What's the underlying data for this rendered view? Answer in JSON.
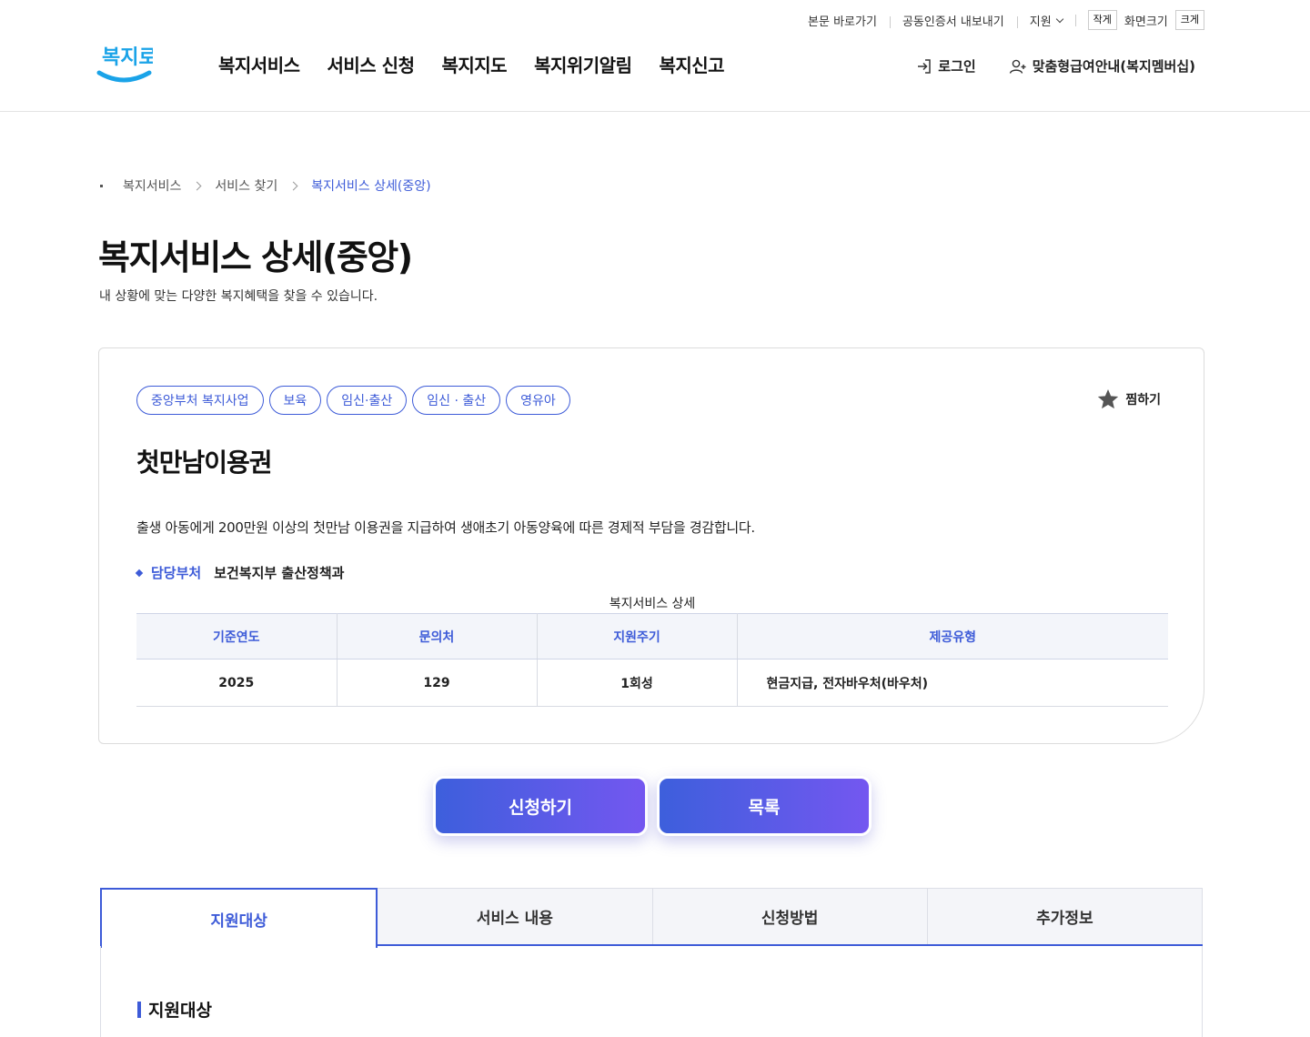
{
  "utility": {
    "skip_to_content": "본문 바로가기",
    "cert_export": "공동인증서 내보내기",
    "support": "지원",
    "zoom_small": "작게",
    "zoom_label": "화면크기",
    "zoom_large": "크게"
  },
  "header": {
    "logo_text": "복지로",
    "gnb": [
      "복지서비스",
      "서비스 신청",
      "복지지도",
      "복지위기알림",
      "복지신고"
    ],
    "login": "로그인",
    "membership": "맞춤형급여안내(복지멤버십)"
  },
  "breadcrumb": [
    "복지서비스",
    "서비스 찾기",
    "복지서비스 상세(중앙)"
  ],
  "page": {
    "title": "복지서비스 상세(중앙)",
    "description": "내 상황에 맞는 다양한 복지혜택을 찾을 수 있습니다."
  },
  "service": {
    "tags": [
      "중앙부처 복지사업",
      "보육",
      "임신·출산",
      "임신 · 출산",
      "영유아"
    ],
    "favorite": "찜하기",
    "name": "첫만남이용권",
    "description": "출생 아동에게 200만원 이상의 첫만남 이용권을 지급하여 생애초기 아동양육에 따른 경제적 부담을 경감합니다.",
    "dept_label": "담당부처",
    "dept_value": "보건복지부 출산정책과",
    "table": {
      "caption": "복지서비스 상세",
      "headers": [
        "기준연도",
        "문의처",
        "지원주기",
        "제공유형"
      ],
      "row": [
        "2025",
        "129",
        "1회성",
        "현금지급, 전자바우처(바우처)"
      ]
    }
  },
  "buttons": {
    "apply": "신청하기",
    "list": "목록"
  },
  "tabs": [
    "지원대상",
    "서비스 내용",
    "신청방법",
    "추가정보"
  ],
  "section": {
    "title": "지원대상"
  },
  "colors": {
    "accent": "#3d5bd8",
    "gradient_start": "#3d5fdc",
    "gradient_end": "#7457f0",
    "logo_blue": "#1aa3e8"
  }
}
